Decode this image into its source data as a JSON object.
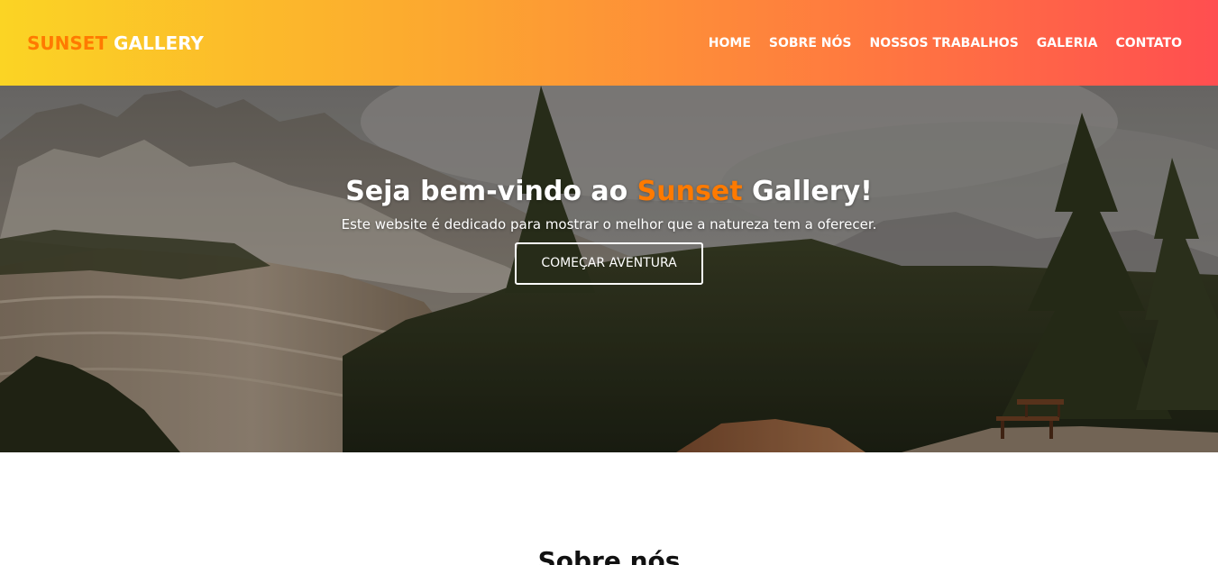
{
  "header": {
    "logo_accent": "SUNSET",
    "logo_rest": " GALLERY",
    "nav": [
      {
        "label": "HOME"
      },
      {
        "label": "SOBRE NÓS"
      },
      {
        "label": "NOSSOS TRABALHOS"
      },
      {
        "label": "GALERIA"
      },
      {
        "label": "CONTATO"
      }
    ],
    "gradient_colors": [
      "#fbd424",
      "#fca92f",
      "#ff7a3f",
      "#ff4e50"
    ]
  },
  "hero": {
    "title_prefix": "Seja bem-vindo ao ",
    "title_accent": "Sunset",
    "title_suffix": " Gallery!",
    "subtitle": "Este website é dedicado para mostrar o melhor que a natureza tem a oferecer.",
    "button_label": "COMEÇAR AVENTURA",
    "accent_color": "#ff7a00"
  },
  "about": {
    "title": "Sobre nós"
  }
}
